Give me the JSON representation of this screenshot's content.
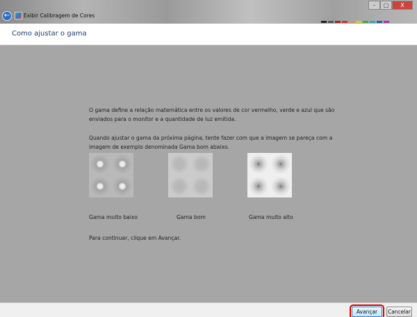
{
  "window": {
    "title": "Exibir Calibragem de Cores",
    "minimize": "–",
    "maximize": "□",
    "close": "X",
    "back": "←"
  },
  "header": {
    "title": "Como ajustar o gama"
  },
  "content": {
    "paragraph1": "O gama define a relação matemática entre os valores de cor vermelho, verde e azul que são enviados para o monitor e a quantidade de luz emitida.",
    "paragraph2": "Quando ajustar o gama da próxima página, tente fazer com que a imagem se pareça com a imagem de exemplo denominada Gama bom abaixo.",
    "samples": [
      {
        "label": "Gama muito baixo"
      },
      {
        "label": "Gama bom"
      },
      {
        "label": "Gama muito alto"
      }
    ],
    "continue": "Para continuar, clique em Avançar."
  },
  "footer": {
    "next": "Avançar",
    "cancel": "Cancelar"
  }
}
